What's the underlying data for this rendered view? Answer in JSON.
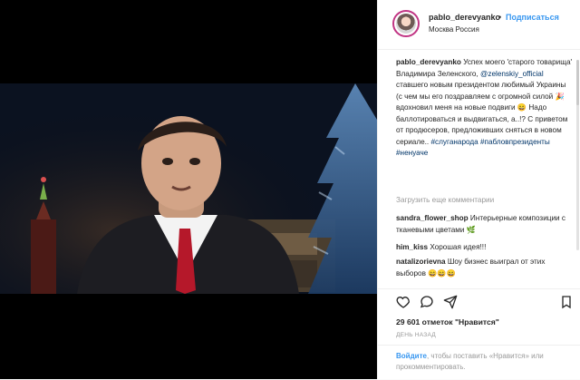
{
  "header": {
    "username": "pablo_derevyanko",
    "dot": "•",
    "follow_label": "Подписаться",
    "location": "Москва Россия"
  },
  "caption": {
    "username": "pablo_derevyanko",
    "text1": "Успех моего 'старого товарища' Владимира Зеленского,",
    "mention": "@zelenskiy_official",
    "text2": "ставшего новым президентом любимый Украины (с чем мы его поздравляем с огромной силой",
    "text3": "вдохновил меня на новые подвиги",
    "text4": "Надо баллотироваться и выдвигаться, а..!? С приветом от продюсеров, предложивших сняться в новом сериале..",
    "hashtags": "#слуганарода #пабловпрезиденты #ненуаче"
  },
  "load_more_label": "Загрузить еще комментарии",
  "comments": [
    {
      "user": "sandra_flower_shop",
      "text": "Интерьерные композиции с тканевыми цветами"
    },
    {
      "user": "him_kiss",
      "text": "Хорошая идея!!!"
    },
    {
      "user": "natalizorievna",
      "text": "Шоу бизнес выиграл от этих выборов"
    }
  ],
  "likes_text": "29 601 отметок \"Нравится\"",
  "date_text": "ДЕНЬ НАЗАД",
  "login": {
    "link": "Войдите",
    "text": ", чтобы поставить «Нравится» или прокомментировать."
  },
  "icons": {
    "like": "heart-outline-icon",
    "comment": "comment-bubble-icon",
    "share": "paper-plane-icon",
    "bookmark": "bookmark-icon"
  },
  "colors": {
    "accent": "#3897f0",
    "text": "#262626",
    "muted": "#999999",
    "border": "#efefef"
  }
}
